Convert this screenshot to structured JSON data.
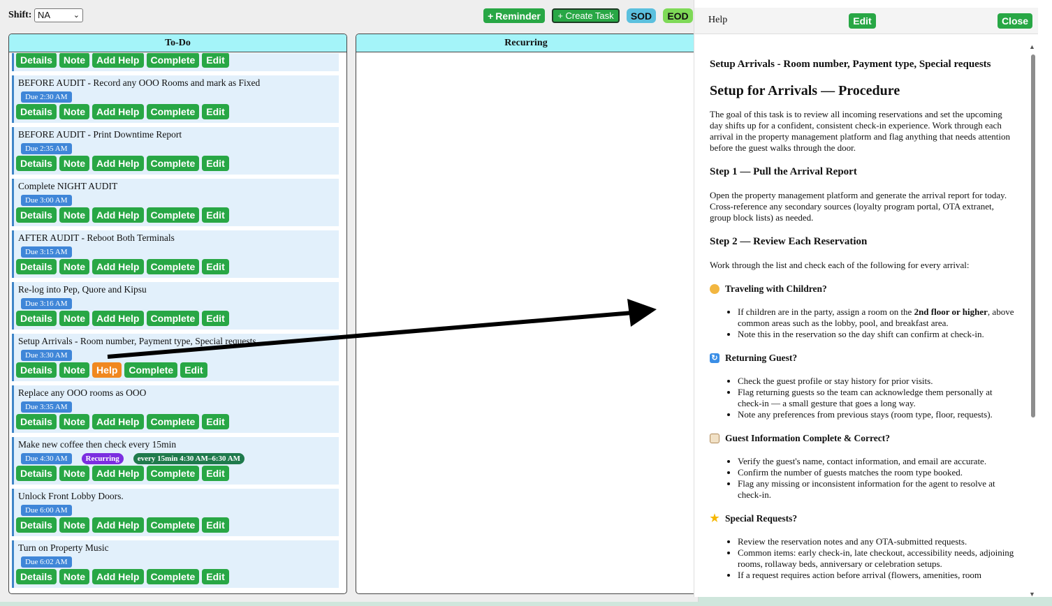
{
  "toolbar": {
    "shift_label": "Shift:",
    "shift_value": "NA",
    "reminder_label": "Reminder",
    "create_task_label": "+ Create Task",
    "sod_label": "SOD",
    "eod_label": "EOD"
  },
  "columns": {
    "todo_title": "To-Do",
    "recurring_title": "Recurring"
  },
  "tasks": [
    {
      "title": "",
      "due": "",
      "actions": [
        "Details",
        "Note",
        "Add Help",
        "Complete",
        "Edit"
      ]
    },
    {
      "title": "BEFORE AUDIT - Record any OOO Rooms and mark as Fixed",
      "due": "Due 2:30 AM",
      "actions": [
        "Details",
        "Note",
        "Add Help",
        "Complete",
        "Edit"
      ]
    },
    {
      "title": "BEFORE AUDIT - Print Downtime Report",
      "due": "Due 2:35 AM",
      "actions": [
        "Details",
        "Note",
        "Add Help",
        "Complete",
        "Edit"
      ]
    },
    {
      "title": "Complete NIGHT AUDIT",
      "due": "Due 3:00 AM",
      "actions": [
        "Details",
        "Note",
        "Add Help",
        "Complete",
        "Edit"
      ]
    },
    {
      "title": "AFTER AUDIT - Reboot Both Terminals",
      "due": "Due 3:15 AM",
      "actions": [
        "Details",
        "Note",
        "Add Help",
        "Complete",
        "Edit"
      ]
    },
    {
      "title": "Re-log into Pep, Quore and Kipsu",
      "due": "Due 3:16 AM",
      "actions": [
        "Details",
        "Note",
        "Add Help",
        "Complete",
        "Edit"
      ]
    },
    {
      "title": "Setup Arrivals - Room number, Payment type, Special requests",
      "due": "Due 3:30 AM",
      "actions": [
        "Details",
        "Note",
        "Help",
        "Complete",
        "Edit"
      ]
    },
    {
      "title": "Replace any OOO rooms as OOO",
      "due": "Due 3:35 AM",
      "actions": [
        "Details",
        "Note",
        "Add Help",
        "Complete",
        "Edit"
      ]
    },
    {
      "title": "Make new coffee then check every 15min",
      "due": "Due 4:30 AM",
      "recurring": "Recurring",
      "frequency": "every 15min 4:30 AM–6:30 AM",
      "actions": [
        "Details",
        "Note",
        "Add Help",
        "Complete",
        "Edit"
      ]
    },
    {
      "title": "Unlock Front Lobby Doors.",
      "due": "Due 6:00 AM",
      "actions": [
        "Details",
        "Note",
        "Add Help",
        "Complete",
        "Edit"
      ]
    },
    {
      "title": "Turn on Property Music",
      "due": "Due 6:02 AM",
      "actions": [
        "Details",
        "Note",
        "Add Help",
        "Complete",
        "Edit"
      ]
    }
  ],
  "help": {
    "panel_title": "Help",
    "edit_label": "Edit",
    "close_label": "Close",
    "task_heading": "Setup Arrivals - Room number, Payment type, Special requests",
    "doc_title": "Setup for Arrivals — Procedure",
    "intro": "The goal of this task is to review all incoming reservations and set the upcoming day shifts up for a confident, consistent check-in experience. Work through each arrival in the property management platform and flag anything that needs attention before the guest walks through the door.",
    "step1_title": "Step 1 — Pull the Arrival Report",
    "step1_text": "Open the property management platform and generate the arrival report for today. Cross-reference any secondary sources (loyalty program portal, OTA extranet, group block lists) as needed.",
    "step2_title": "Step 2 — Review Each Reservation",
    "step2_text": "Work through the list and check each of the following for every arrival:",
    "sec_children_title": "Traveling with Children?",
    "sec_children_item1_pre": "If children are in the party, assign a room on the ",
    "sec_children_item1_bold": "2nd floor or higher",
    "sec_children_item1_post": ", above common areas such as the lobby, pool, and breakfast area.",
    "sec_children_item2": "Note this in the reservation so the day shift can confirm at check-in.",
    "sec_returning_title": "Returning Guest?",
    "sec_returning_item1": "Check the guest profile or stay history for prior visits.",
    "sec_returning_item2": "Flag returning guests so the team can acknowledge them personally at check-in — a small gesture that goes a long way.",
    "sec_returning_item3": "Note any preferences from previous stays (room type, floor, requests).",
    "sec_info_title": "Guest Information Complete & Correct?",
    "sec_info_item1": "Verify the guest's name, contact information, and email are accurate.",
    "sec_info_item2": "Confirm the number of guests matches the room type booked.",
    "sec_info_item3": "Flag any missing or inconsistent information for the agent to resolve at check-in.",
    "sec_special_title": "Special Requests?",
    "sec_special_item1": "Review the reservation notes and any OTA-submitted requests.",
    "sec_special_item2": "Common items: early check-in, late checkout, accessibility needs, adjoining rooms, rollaway beds, anniversary or celebration setups.",
    "sec_special_item3": "If a request requires action before arrival (flowers, amenities, room"
  },
  "icons": {
    "children": "baby-icon",
    "returning": "returning-icon",
    "info": "clipboard-icon",
    "special": "star-icon"
  },
  "colors": {
    "action_green": "#28a745",
    "help_orange": "#f0881f",
    "header_cyan": "#a4f4f9",
    "due_blue": "#3f86d8",
    "recurring_purple": "#7b2ee0",
    "frequency_green": "#1f7a4c"
  }
}
